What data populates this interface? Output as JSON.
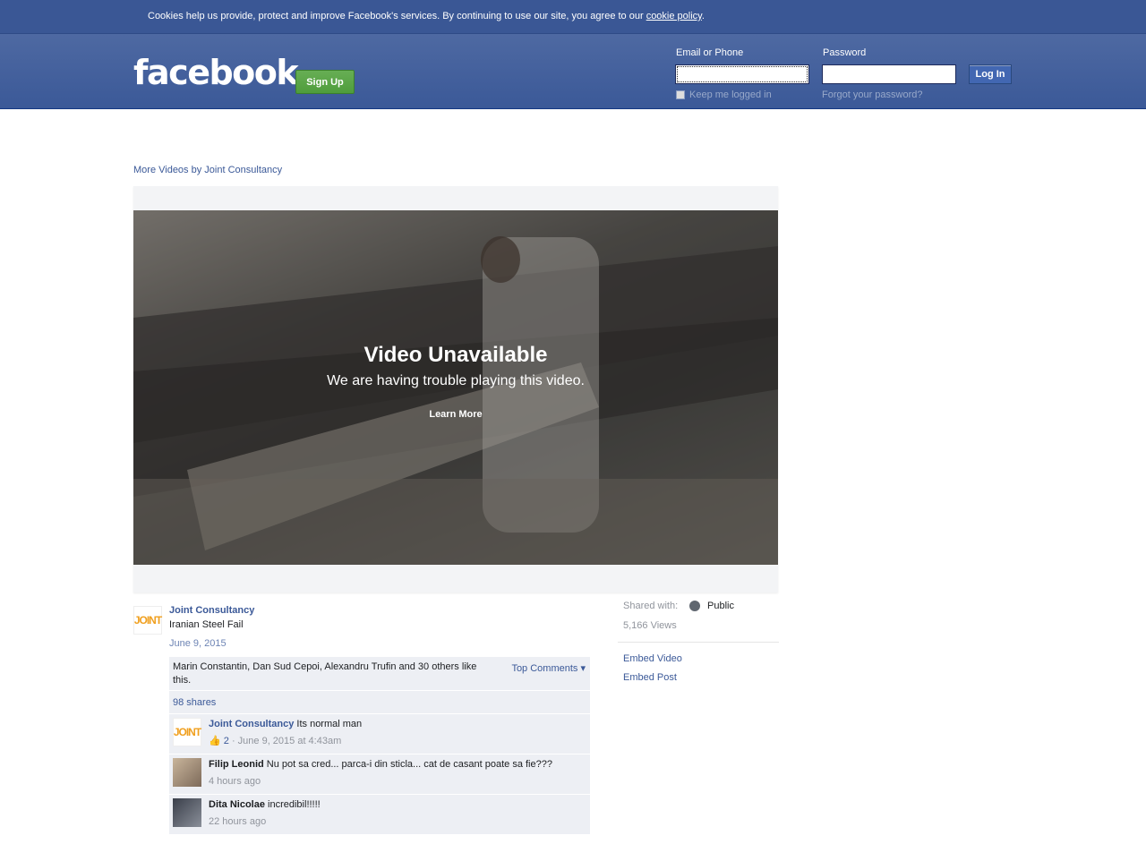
{
  "cookie_bar": {
    "text": "Cookies help us provide, protect and improve Facebook's services. By continuing to use our site, you agree to our ",
    "link": "cookie policy",
    "suffix": "."
  },
  "header": {
    "logo": "facebook",
    "signup": "Sign Up",
    "email_label": "Email or Phone",
    "password_label": "Password",
    "login": "Log In",
    "keep_logged_in": "Keep me logged in",
    "forgot": "Forgot your password?"
  },
  "content": {
    "more_videos": "More Videos by Joint Consultancy",
    "video": {
      "title": "Video Unavailable",
      "subtitle": "We are having trouble playing this video.",
      "learn_more": "Learn More"
    },
    "post": {
      "page_name": "Joint Consultancy",
      "title": "Iranian Steel Fail",
      "date": "June 9, 2015",
      "avatar_text": "JOINT"
    },
    "ufi": {
      "likes": "Marin Constantin, Dan Sud Cepoi, Alexandru Trufin and 30 others like this.",
      "top_comments": "Top Comments ▾",
      "shares": "98 shares"
    },
    "comments": [
      {
        "author": "Joint Consultancy",
        "text": "Its normal man",
        "likes": "2",
        "meta": " · June 9, 2015 at 4:43am"
      },
      {
        "author": "Filip Leonid",
        "text": "Nu pot sa cred... parca-i din sticla... cat de casant poate sa fie???",
        "meta": "4 hours ago"
      },
      {
        "author": "Dita Nicolae",
        "text": "incredibil!!!!!",
        "meta": "22 hours ago"
      }
    ]
  },
  "sidebar": {
    "shared_with": "Shared with:",
    "privacy": "Public",
    "views": "5,166 Views",
    "embed_video": "Embed Video",
    "embed_post": "Embed Post"
  },
  "colors": {
    "brand": "#3b5998",
    "signup_green": "#4f9d3c",
    "ufi_bg": "#edeff4"
  },
  "icons": [
    "globe-icon",
    "like-thumb-icon",
    "checkbox-icon"
  ]
}
